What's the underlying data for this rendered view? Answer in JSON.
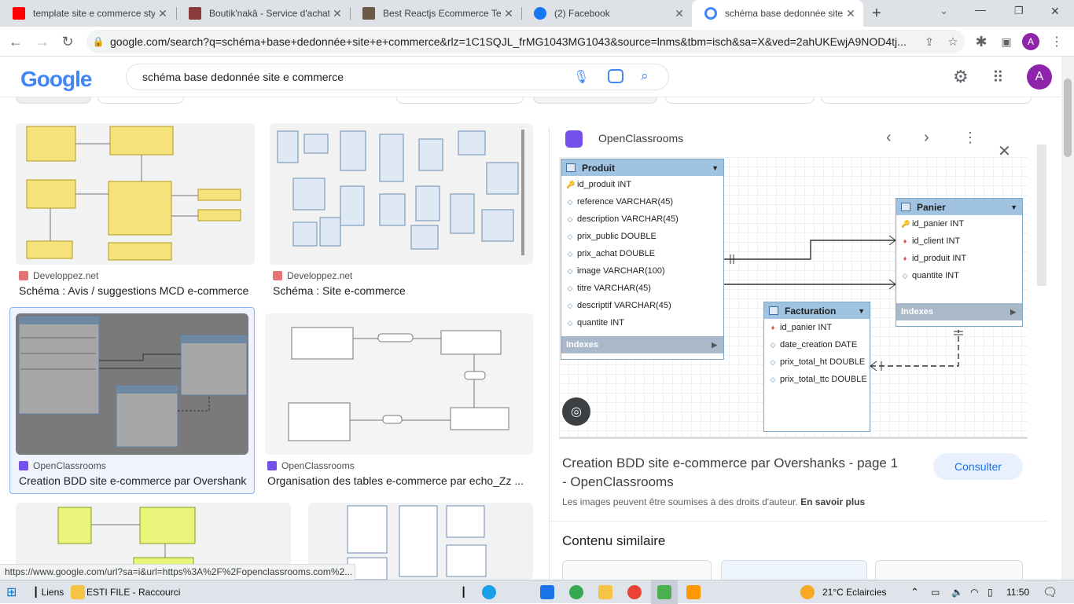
{
  "browser": {
    "tabs": [
      {
        "title": "template site e commerce style",
        "color": "#ff0000"
      },
      {
        "title": "Boutik'nakâ - Service d'achat",
        "color": "#8b3a3a"
      },
      {
        "title": "Best Reactjs Ecommerce Tem",
        "color": "#6b5a4a"
      },
      {
        "title": "(2) Facebook",
        "color": "#1877f2"
      },
      {
        "title": "schéma base dedonnée site e",
        "color": "#4285f4"
      }
    ],
    "url": "google.com/search?q=schéma+base+dedonnée+site+e+commerce&rlz=1C1SQJL_frMG1043MG1043&source=lnms&tbm=isch&sa=X&ved=2ahUKEwjA9NOD4tj...",
    "profile_initial": "A"
  },
  "google": {
    "logo": "Google",
    "query": "schéma base dedonnée site e commerce",
    "account_initial": "A"
  },
  "results": [
    {
      "source": "Developpez.net",
      "title": "Schéma : Avis / suggestions MCD e-commerce"
    },
    {
      "source": "Developpez.net",
      "title": "Schéma : Site e-commerce"
    },
    {
      "source": "OpenClassrooms",
      "title": "Creation BDD site e-commerce par Overshanks"
    },
    {
      "source": "OpenClassrooms",
      "title": "Organisation des tables e-commerce par echo_Zz ..."
    }
  ],
  "preview": {
    "source": "OpenClassrooms",
    "title_line1": "Creation BDD site e-commerce par Overshanks - page 1",
    "title_line2": "- OpenClassrooms",
    "consult_label": "Consulter",
    "notice": "Les images peuvent être soumises à des droits d'auteur.",
    "notice_link": "En savoir plus",
    "similar": "Contenu similaire",
    "diagram": {
      "produit": {
        "name": "Produit",
        "rows": [
          "id_produit INT",
          "reference VARCHAR(45)",
          "description VARCHAR(45)",
          "prix_public DOUBLE",
          "prix_achat DOUBLE",
          "image VARCHAR(100)",
          "titre VARCHAR(45)",
          "descriptif VARCHAR(45)",
          "quantite INT"
        ],
        "indexes": "Indexes"
      },
      "panier": {
        "name": "Panier",
        "rows": [
          "id_panier INT",
          "id_client INT",
          "id_produit INT",
          "quantite INT"
        ],
        "indexes": "Indexes"
      },
      "facturation": {
        "name": "Facturation",
        "rows": [
          "id_panier INT",
          "date_creation DATE",
          "prix_total_ht DOUBLE",
          "prix_total_ttc DOUBLE"
        ]
      }
    }
  },
  "status_url": "https://www.google.com/url?sa=i&url=https%3A%2F%2Fopenclassrooms.com%2...",
  "taskbar": {
    "liens": "Liens",
    "folder": "ESTI FILE - Raccourci",
    "weather": "21°C  Eclaircies",
    "time": "11:50"
  }
}
